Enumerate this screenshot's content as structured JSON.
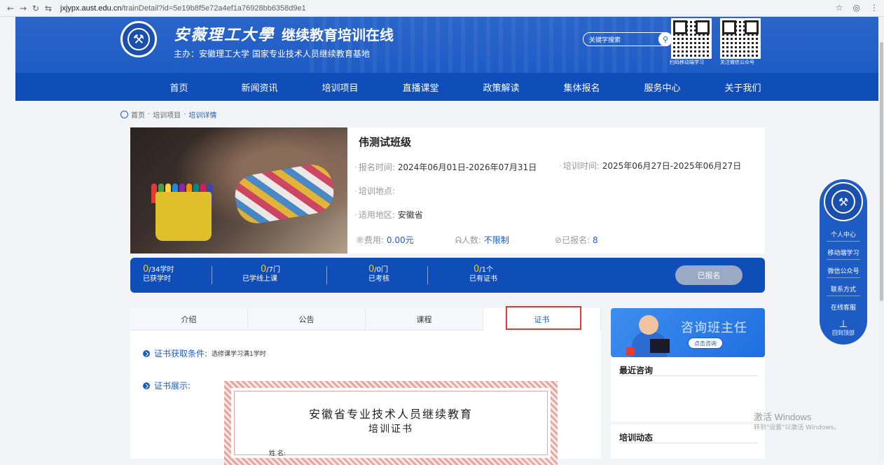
{
  "browser": {
    "url_domain": "jxjypx.aust.edu.cn",
    "url_path": "/trainDetail?id=5e19b8f5e72a4ef1a76928bb6358d9e1"
  },
  "header": {
    "university_name": "安薇理工大學",
    "site_name": "继续教育培训在线",
    "host_line": "主办：安徽理工大学  国家专业技术人员继续教育基地",
    "search_placeholder": "关键字搜索",
    "qr_captions": [
      "扫码移动端学习",
      "关注微信公众号"
    ]
  },
  "nav": {
    "items": [
      "首页",
      "新闻资讯",
      "培训项目",
      "直播课堂",
      "政策解读",
      "集体报名",
      "服务中心",
      "关于我们"
    ]
  },
  "breadcrumb": {
    "home": "首页",
    "mid": "培训项目",
    "current": "培训详情",
    "sep": "·"
  },
  "course": {
    "title": "伟测试班级",
    "signup_time_label": "报名时间:",
    "signup_time_value": "2024年06月01日-2026年07月31日",
    "train_time_label": "培训时间:",
    "train_time_value": "2025年06月27日-2025年06月27日",
    "location_label": "培训地点:",
    "location_value": "",
    "region_label": "适用地区:",
    "region_value": "安徽省",
    "fee_label": "费用:",
    "fee_value": "0.00元",
    "people_label": "人数:",
    "people_value": "不限制",
    "signed_label": "已报名:",
    "signed_value": "8"
  },
  "stats": {
    "items": [
      {
        "num": "0",
        "total": "/34学时",
        "label": "已获学时"
      },
      {
        "num": "0",
        "total": "/7门",
        "label": "已学线上课"
      },
      {
        "num": "0",
        "total": "/0门",
        "label": "已考核"
      },
      {
        "num": "0",
        "total": "/1个",
        "label": "已有证书"
      }
    ],
    "button": "已报名"
  },
  "tabs": {
    "items": [
      "介绍",
      "公告",
      "课程",
      "证书"
    ],
    "active_index": 3
  },
  "certificate": {
    "condition_label": "证书获取条件:",
    "condition_value": "选修课学习满1学时",
    "display_label": "证书展示:",
    "cert_title_1": "安徽省专业技术人员继续教育",
    "cert_title_2": "培训证书",
    "cert_name_label": "姓      名:"
  },
  "sidebar_right": {
    "consult_title": "咨询班主任",
    "consult_button": "点击咨询",
    "recent_title": "最近咨询",
    "dynamic_title": "培训动态"
  },
  "float_bar": {
    "items": [
      "个人中心",
      "移动端学习",
      "微信公众号",
      "联系方式",
      "在线客服"
    ],
    "back_top": "回到顶部"
  },
  "watermark": {
    "line1": "激活 Windows",
    "line2": "转到\"设置\"以激活 Windows。"
  },
  "colors": {
    "brand_blue": "#1e5cc5",
    "nav_blue": "#0f4eb8",
    "highlight_red": "#e53935",
    "stat_yellow": "#f5c518"
  }
}
